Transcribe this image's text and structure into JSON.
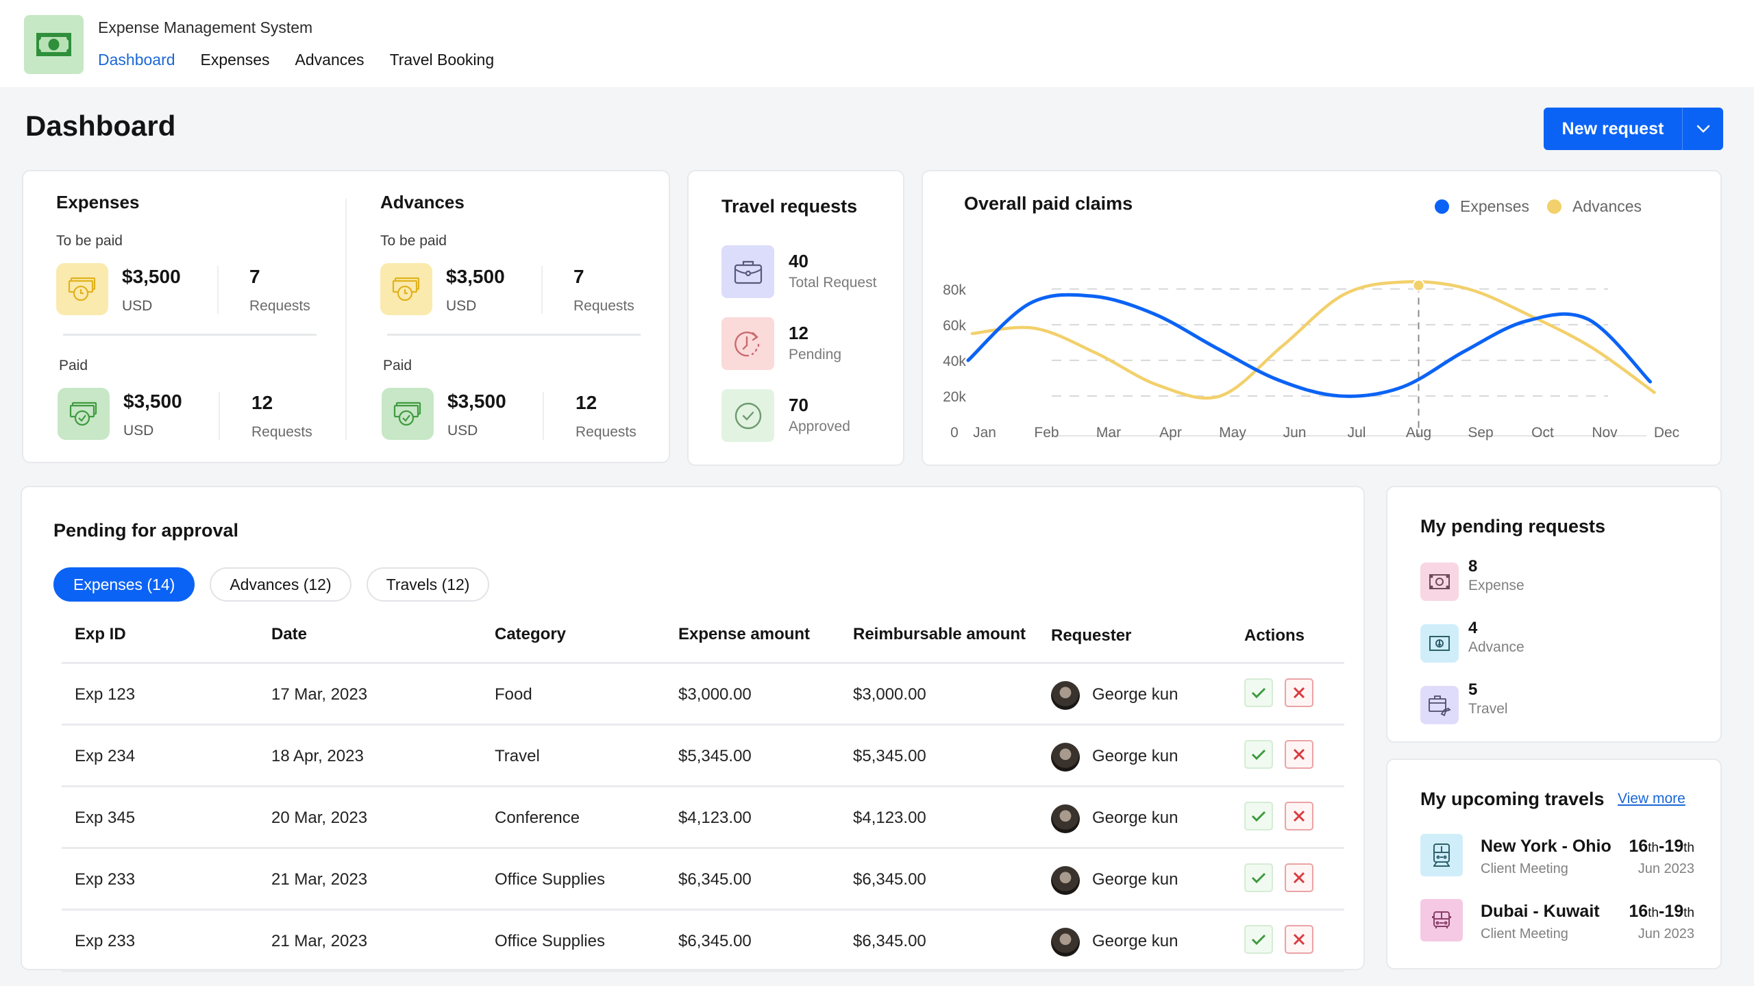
{
  "app": {
    "title": "Expense Management System",
    "logo_icon": "banknote-icon",
    "nav": [
      {
        "label": "Dashboard",
        "active": true
      },
      {
        "label": "Expenses",
        "active": false
      },
      {
        "label": "Advances",
        "active": false
      },
      {
        "label": "Travel Booking",
        "active": false
      }
    ]
  },
  "page": {
    "title": "Dashboard",
    "new_request_label": "New request",
    "new_request_dropdown_icon": "chevron-down-icon"
  },
  "colors": {
    "primary": "#0b63f5",
    "expenses_line": "#0b63f5",
    "advances_line": "#f2d06b",
    "approve": "#3f9a3f",
    "reject": "#d93a3f"
  },
  "summary": {
    "expenses": {
      "title": "Expenses",
      "to_be_paid": {
        "label": "To be paid",
        "amount": "$3,500",
        "currency": "USD",
        "count": "7",
        "count_label": "Requests"
      },
      "paid": {
        "label": "Paid",
        "amount": "$3,500",
        "currency": "USD",
        "count": "12",
        "count_label": "Requests"
      }
    },
    "advances": {
      "title": "Advances",
      "to_be_paid": {
        "label": "To be paid",
        "amount": "$3,500",
        "currency": "USD",
        "count": "7",
        "count_label": "Requests"
      },
      "paid": {
        "label": "Paid",
        "amount": "$3,500",
        "currency": "USD",
        "count": "12",
        "count_label": "Requests"
      }
    }
  },
  "travel_requests": {
    "title": "Travel requests",
    "items": [
      {
        "value": "40",
        "label": "Total Request",
        "icon": "briefcase-icon"
      },
      {
        "value": "12",
        "label": "Pending",
        "icon": "clock-rotate-icon"
      },
      {
        "value": "70",
        "label": "Approved",
        "icon": "check-circle-icon"
      }
    ]
  },
  "chart_data": {
    "type": "line",
    "title": "Overall paid claims",
    "categories": [
      "Jan",
      "Feb",
      "Mar",
      "Apr",
      "May",
      "Jun",
      "Jul",
      "Aug",
      "Sep",
      "Oct",
      "Nov",
      "Dec"
    ],
    "series": [
      {
        "name": "Expenses",
        "color": "#0b63f5",
        "values": [
          40000,
          72000,
          76000,
          66000,
          47000,
          29000,
          20000,
          25000,
          45000,
          62000,
          63000,
          28000
        ]
      },
      {
        "name": "Advances",
        "color": "#f2d06b",
        "values": [
          55000,
          58000,
          44000,
          26000,
          20000,
          48000,
          77000,
          84000,
          80000,
          65000,
          47000,
          22000
        ]
      }
    ],
    "highlight": {
      "series": "Advances",
      "x": "Aug",
      "value": 82000
    },
    "yticks": [
      "0",
      "20k",
      "40k",
      "60k",
      "80k"
    ],
    "ylim": [
      0,
      80000
    ],
    "grid": true,
    "legend": "top-right",
    "xlabel": "",
    "ylabel": ""
  },
  "pending_approval": {
    "title": "Pending for approval",
    "tabs": [
      {
        "label": "Expenses (14)",
        "active": true
      },
      {
        "label": "Advances (12)",
        "active": false
      },
      {
        "label": "Travels (12)",
        "active": false
      }
    ],
    "columns": [
      "Exp ID",
      "Date",
      "Category",
      "Expense amount",
      "Reimbursable amount",
      "Requester",
      "Actions"
    ],
    "rows": [
      {
        "id": "Exp 123",
        "date": "17 Mar, 2023",
        "category": "Food",
        "expense": "$3,000.00",
        "reimbursable": "$3,000.00",
        "requester": "George kun"
      },
      {
        "id": "Exp 234",
        "date": "18 Apr, 2023",
        "category": "Travel",
        "expense": "$5,345.00",
        "reimbursable": "$5,345.00",
        "requester": "George kun"
      },
      {
        "id": "Exp 345",
        "date": "20 Mar, 2023",
        "category": "Conference",
        "expense": "$4,123.00",
        "reimbursable": "$4,123.00",
        "requester": "George kun"
      },
      {
        "id": "Exp 233",
        "date": "21 Mar, 2023",
        "category": "Office Supplies",
        "expense": "$6,345.00",
        "reimbursable": "$6,345.00",
        "requester": "George kun"
      },
      {
        "id": "Exp 233",
        "date": "21 Mar, 2023",
        "category": "Office Supplies",
        "expense": "$6,345.00",
        "reimbursable": "$6,345.00",
        "requester": "George kun"
      }
    ]
  },
  "my_pending": {
    "title": "My pending requests",
    "items": [
      {
        "value": "8",
        "label": "Expense",
        "icon": "banknote-icon"
      },
      {
        "value": "4",
        "label": "Advance",
        "icon": "cash-down-icon"
      },
      {
        "value": "5",
        "label": "Travel",
        "icon": "briefcase-plane-icon"
      }
    ]
  },
  "upcoming_travels": {
    "title": "My upcoming travels",
    "view_more": "View more",
    "items": [
      {
        "route": "New York - Ohio",
        "purpose": "Client Meeting",
        "day_start": "16",
        "day_start_suffix": "th",
        "sep": "-",
        "day_end": "19",
        "day_end_suffix": "th",
        "month": "Jun 2023",
        "icon": "train-icon"
      },
      {
        "route": "Dubai - Kuwait",
        "purpose": "Client Meeting",
        "day_start": "16",
        "day_start_suffix": "th",
        "sep": "-",
        "day_end": "19",
        "day_end_suffix": "th",
        "month": "Jun 2023",
        "icon": "bus-icon"
      }
    ]
  }
}
